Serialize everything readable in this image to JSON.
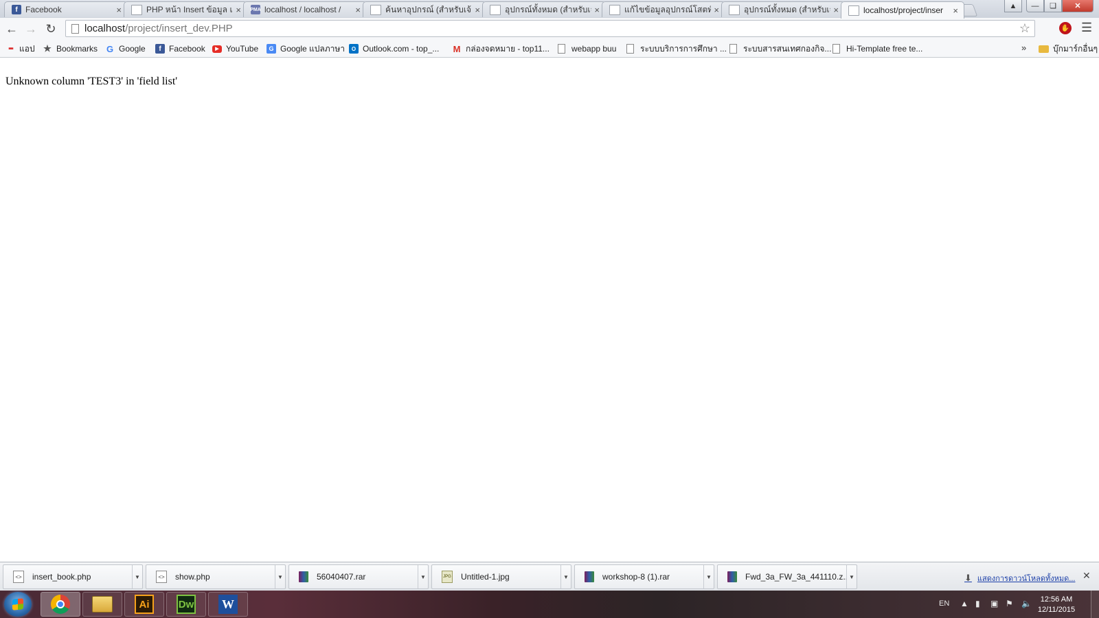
{
  "browser": {
    "tabs": [
      {
        "title": "Facebook",
        "favicon": "facebook-icon"
      },
      {
        "title": "PHP หน้า Insert ข้อมูล แ",
        "favicon": "page-icon"
      },
      {
        "title": "localhost / localhost / ",
        "favicon": "phpmyadmin-icon"
      },
      {
        "title": "ค้นหาอุปกรณ์ (สำหรับเจ้าห",
        "favicon": "page-icon"
      },
      {
        "title": "อุปกรณ์ทั้งหมด (สำหรับเจ้",
        "favicon": "page-icon"
      },
      {
        "title": "แก้ไขข้อมูลอุปกรณ์โสตทัศ",
        "favicon": "page-icon"
      },
      {
        "title": "อุปกรณ์ทั้งหมด (สำหรับเจ้",
        "favicon": "page-icon"
      },
      {
        "title": "localhost/project/inser",
        "favicon": "page-icon",
        "active": true
      }
    ],
    "tab_close_glyph": "×",
    "address": {
      "host": "localhost",
      "path": "/project/insert_dev.PHP"
    },
    "bookmarks": [
      {
        "label": "แอป",
        "icon": "apps-icon"
      },
      {
        "label": "Bookmarks",
        "icon": "star-icon"
      },
      {
        "label": "Google",
        "icon": "google-icon"
      },
      {
        "label": "Facebook",
        "icon": "facebook-icon"
      },
      {
        "label": "YouTube",
        "icon": "youtube-icon"
      },
      {
        "label": "Google แปลภาษา",
        "icon": "google-translate-icon"
      },
      {
        "label": "Outlook.com - top_...",
        "icon": "outlook-icon"
      },
      {
        "label": "กล่องจดหมาย - top11...",
        "icon": "gmail-icon"
      },
      {
        "label": "webapp buu",
        "icon": "page-icon"
      },
      {
        "label": "ระบบบริการการศึกษา ...",
        "icon": "page-icon"
      },
      {
        "label": "ระบบสารสนเทศกองกิจ...",
        "icon": "page-icon"
      },
      {
        "label": "Hi-Template free te...",
        "icon": "page-icon"
      }
    ],
    "bookmarks_overflow": "»",
    "other_bookmarks": "บุ๊กมาร์กอื่นๆ"
  },
  "page": {
    "error_message": "Unknown column 'TEST3' in 'field list'"
  },
  "downloads": {
    "items": [
      {
        "name": "insert_book.php",
        "icon": "php-file-icon"
      },
      {
        "name": "show.php",
        "icon": "php-file-icon"
      },
      {
        "name": "56040407.rar",
        "icon": "rar-archive-icon"
      },
      {
        "name": "Untitled-1.jpg",
        "icon": "jpg-file-icon"
      },
      {
        "name": "workshop-8 (1).rar",
        "icon": "rar-archive-icon"
      },
      {
        "name": "Fwd_3a_FW_3a_441110.z...",
        "icon": "rar-archive-icon"
      }
    ],
    "show_all": "แสดงการดาวน์โหลดทั้งหมด..."
  },
  "taskbar": {
    "apps": [
      {
        "name": "chrome",
        "icon": "chrome-icon",
        "active": true
      },
      {
        "name": "explorer",
        "icon": "folder-icon"
      },
      {
        "name": "illustrator",
        "label": "Ai",
        "icon": "illustrator-icon"
      },
      {
        "name": "dreamweaver",
        "label": "Dw",
        "icon": "dreamweaver-icon"
      },
      {
        "name": "word",
        "label": "W",
        "icon": "word-icon"
      }
    ],
    "language": "EN",
    "time": "12:56 AM",
    "date": "12/11/2015"
  }
}
